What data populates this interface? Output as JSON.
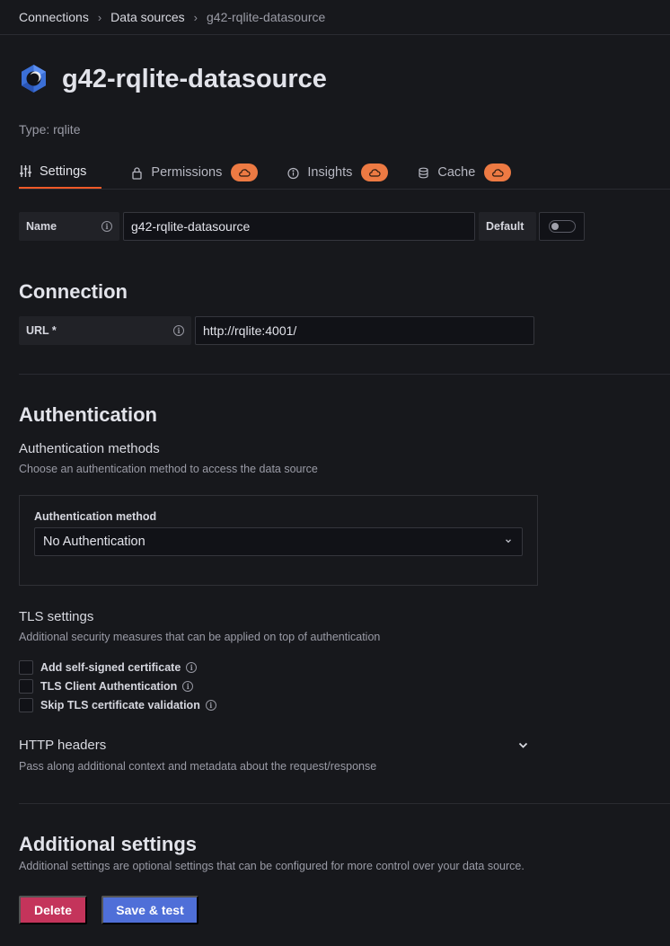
{
  "breadcrumb": {
    "items": [
      "Connections",
      "Data sources"
    ],
    "current": "g42-rqlite-datasource"
  },
  "header": {
    "title": "g42-rqlite-datasource",
    "type_line": "Type: rqlite",
    "logo": "rqlite-logo-icon"
  },
  "tabs": [
    {
      "label": "Settings",
      "icon": "sliders-icon",
      "active": true
    },
    {
      "label": "Permissions",
      "icon": "lock-icon",
      "badge_icon": "cloud-icon"
    },
    {
      "label": "Insights",
      "icon": "info-icon",
      "badge_icon": "cloud-icon"
    },
    {
      "label": "Cache",
      "icon": "database-icon",
      "badge_icon": "cloud-icon"
    }
  ],
  "name_row": {
    "label": "Name",
    "value": "g42-rqlite-datasource",
    "default_label": "Default",
    "default_on": false
  },
  "connection": {
    "heading": "Connection",
    "url_label": "URL *",
    "url_value": "http://rqlite:4001/"
  },
  "authentication": {
    "heading": "Authentication",
    "methods_title": "Authentication methods",
    "methods_desc": "Choose an authentication method to access the data source",
    "method_label": "Authentication method",
    "method_value": "No Authentication"
  },
  "tls": {
    "title": "TLS settings",
    "desc": "Additional security measures that can be applied on top of authentication",
    "options": [
      {
        "label": "Add self-signed certificate",
        "checked": false
      },
      {
        "label": "TLS Client Authentication",
        "checked": false
      },
      {
        "label": "Skip TLS certificate validation",
        "checked": false
      }
    ]
  },
  "http_headers": {
    "title": "HTTP headers",
    "desc": "Pass along additional context and metadata about the request/response"
  },
  "additional": {
    "heading": "Additional settings",
    "desc": "Additional settings are optional settings that can be configured for more control over your data source."
  },
  "buttons": {
    "delete": "Delete",
    "save_test": "Save & test"
  },
  "colors": {
    "background": "#17181c",
    "tab_accent": "#f05a28",
    "badge": "#ed7a43",
    "delete": "#c4345b",
    "primary": "#4f6fd8"
  }
}
